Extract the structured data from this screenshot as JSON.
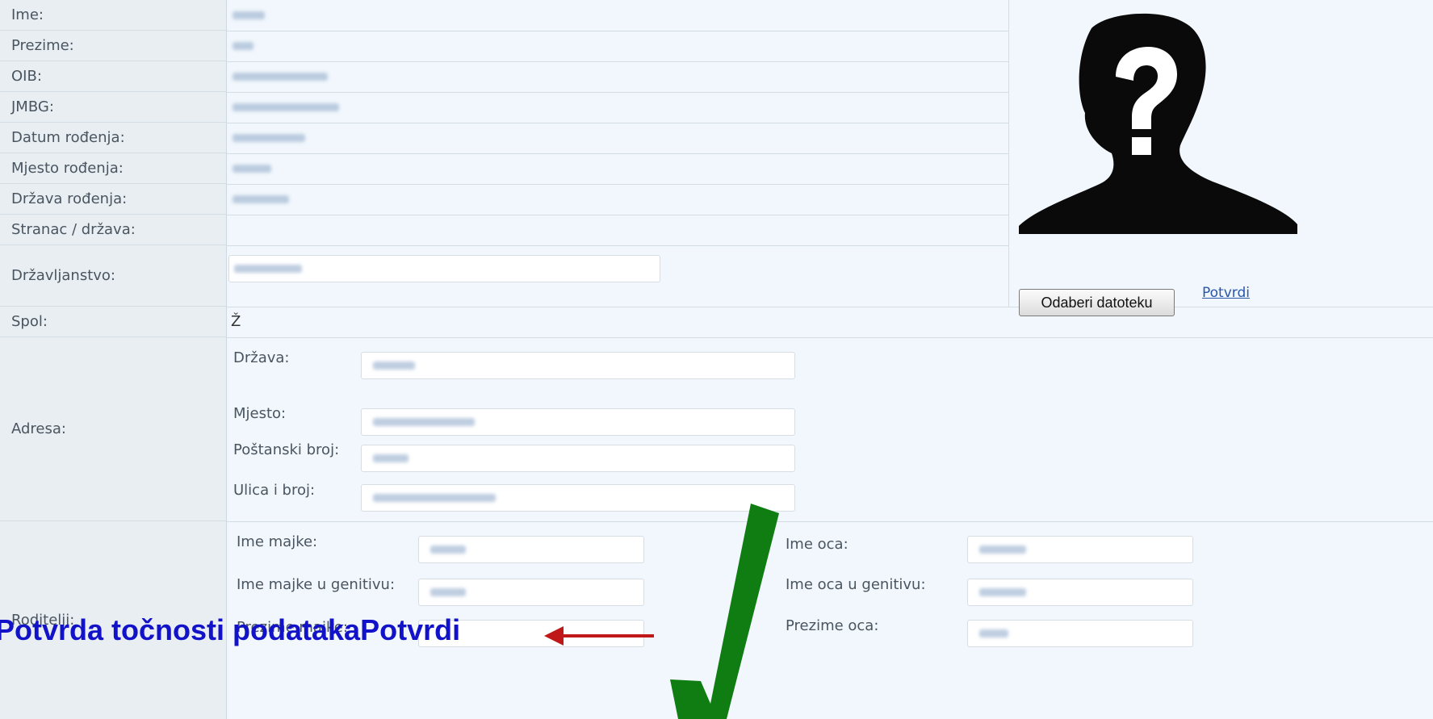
{
  "labels": {
    "ime": "Ime:",
    "prezime": "Prezime:",
    "oib": "OIB:",
    "jmbg": "JMBG:",
    "datum_rodenja": "Datum rođenja:",
    "mjesto_rodenja": "Mjesto rođenja:",
    "drzava_rodenja": "Država rođenja:",
    "stranac": "Stranac / država:",
    "drzavljanstvo": "Državljanstvo:",
    "spol": "Spol:",
    "adresa": "Adresa:",
    "roditelji": "Roditelji:"
  },
  "spol_value": "Ž",
  "address": {
    "drzava": "Država:",
    "mjesto": "Mjesto:",
    "postanski_broj": "Poštanski broj:",
    "ulica": "Ulica i broj:"
  },
  "parents": {
    "ime_majke": "Ime majke:",
    "ime_majke_genitiv": "Ime majke u genitivu:",
    "prezime_majke": "Prezime majke:",
    "ime_oca": "Ime oca:",
    "ime_oca_genitiv": "Ime oca u genitivu:",
    "prezime_oca": "Prezime oca:"
  },
  "photo": {
    "choose_file": "Odaberi datoteku",
    "confirm_link": "Potvrdi"
  },
  "overlay": {
    "text": "Potvrda točnosti podataka",
    "button_text": "Potvrdi"
  },
  "colors": {
    "link": "#2a56a8",
    "overlay_text": "#1212c8",
    "check": "#0f7d12",
    "arrow": "#c01818"
  }
}
